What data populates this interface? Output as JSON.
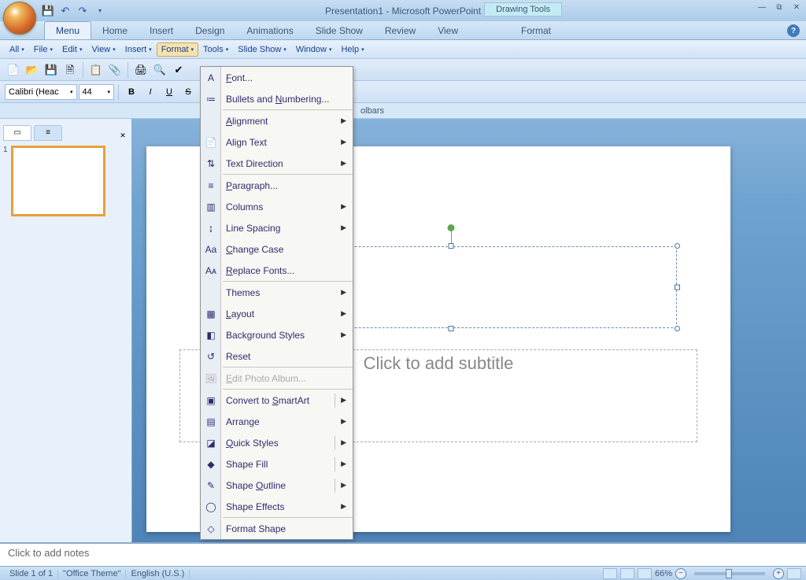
{
  "titlebar": {
    "title": "Presentation1 - Microsoft PowerPoint",
    "context_tab": "Drawing Tools"
  },
  "ribbon_tabs": [
    "Menu",
    "Home",
    "Insert",
    "Design",
    "Animations",
    "Slide Show",
    "Review",
    "View"
  ],
  "ribbon_context_tab": "Format",
  "classic_menu": {
    "items": [
      "All",
      "File",
      "Edit",
      "View",
      "Insert",
      "Format",
      "Tools",
      "Slide Show",
      "Window",
      "Help"
    ],
    "open_index": 5
  },
  "toolbar2": {
    "font_name": "Calibri (Heac",
    "font_size": "44"
  },
  "toolbar_options_label": "olbars",
  "dropdown": [
    {
      "label": "Font...",
      "icon": "A",
      "underline": "F"
    },
    {
      "label": "Bullets and Numbering...",
      "icon": "≔",
      "underline": "N"
    },
    {
      "sep": true
    },
    {
      "label": "Alignment",
      "icon": "",
      "arrow": true,
      "underline": "A"
    },
    {
      "label": "Align Text",
      "icon": "📄",
      "arrow": true
    },
    {
      "label": "Text Direction",
      "icon": "⇅",
      "arrow": true
    },
    {
      "sep": true
    },
    {
      "label": "Paragraph...",
      "icon": "≡",
      "underline": "P"
    },
    {
      "label": "Columns",
      "icon": "▥",
      "arrow": true
    },
    {
      "label": "Line Spacing",
      "icon": "↨",
      "arrow": true
    },
    {
      "label": "Change Case",
      "icon": "Aa",
      "underline": "C"
    },
    {
      "label": "Replace Fonts...",
      "icon": "Aᴀ",
      "underline": "R"
    },
    {
      "sep": true
    },
    {
      "label": "Themes",
      "icon": "",
      "arrow": true
    },
    {
      "label": "Layout",
      "icon": "▦",
      "arrow": true,
      "underline": "L"
    },
    {
      "label": "Background Styles",
      "icon": "◧",
      "arrow": true
    },
    {
      "label": "Reset",
      "icon": "↺"
    },
    {
      "sep": true
    },
    {
      "label": "Edit Photo Album...",
      "icon": "🖼",
      "disabled": true,
      "underline": "E"
    },
    {
      "sep": true
    },
    {
      "label": "Convert to SmartArt",
      "icon": "▣",
      "arrow": true,
      "split": true,
      "underline": "S"
    },
    {
      "label": "Arrange",
      "icon": "▤",
      "arrow": true
    },
    {
      "label": "Quick Styles",
      "icon": "◪",
      "arrow": true,
      "split": true,
      "underline": "Q"
    },
    {
      "label": "Shape Fill",
      "icon": "◆",
      "arrow": true,
      "split": true
    },
    {
      "label": "Shape Outline",
      "icon": "✎",
      "arrow": true,
      "split": true,
      "underline": "O"
    },
    {
      "label": "Shape Effects",
      "icon": "◯",
      "arrow": true
    },
    {
      "sep": true
    },
    {
      "label": "Format Shape",
      "icon": "◇"
    }
  ],
  "slide": {
    "subtitle_placeholder": "Click to add subtitle"
  },
  "notes_placeholder": "Click to add notes",
  "status": {
    "slide": "Slide 1 of 1",
    "theme": "\"Office Theme\"",
    "lang": "English (U.S.)",
    "zoom": "66%"
  }
}
